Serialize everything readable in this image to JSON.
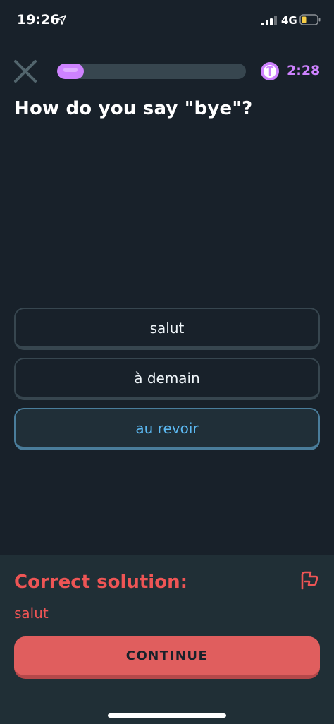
{
  "status_bar": {
    "time": "19:26",
    "network": "4G"
  },
  "header": {
    "progress": 0.14,
    "timer": "2:28"
  },
  "question": "How do you say \"bye\"?",
  "options": [
    {
      "label": "salut",
      "selected": false
    },
    {
      "label": "à demain",
      "selected": false
    },
    {
      "label": "au revoir",
      "selected": true
    }
  ],
  "feedback": {
    "title": "Correct solution:",
    "answer": "salut",
    "continue_label": "CONTINUE"
  },
  "colors": {
    "background": "#18212a",
    "accent_purple": "#ce82ff",
    "selected_blue": "#5cb9f2",
    "error_red": "#ee5555",
    "button_red": "#e05e5e"
  },
  "icons": [
    "location-arrow-icon",
    "signal-icon",
    "battery-icon",
    "close-icon",
    "timer-icon",
    "flag-icon"
  ]
}
